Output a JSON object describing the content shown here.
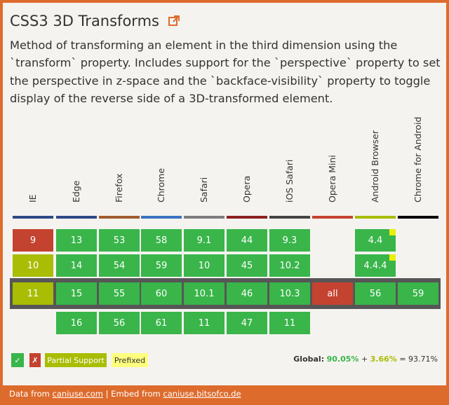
{
  "title": "CSS3 3D Transforms",
  "description": "Method of transforming an element in the third dimension using the `transform` property. Includes support for the `perspective` property to set the perspective in z-space and the `backface-visibility` property to toggle display of the reverse side of a 3D-transformed element.",
  "browsers": [
    {
      "name": "IE",
      "color": "#2e4986"
    },
    {
      "name": "Edge",
      "color": "#2e4986"
    },
    {
      "name": "Firefox",
      "color": "#a05b2d"
    },
    {
      "name": "Chrome",
      "color": "#3b73c0"
    },
    {
      "name": "Safari",
      "color": "#7d7d7d"
    },
    {
      "name": "Opera",
      "color": "#8b2020"
    },
    {
      "name": "iOS Safari",
      "color": "#444444"
    },
    {
      "name": "Opera Mini",
      "color": "#c44230"
    },
    {
      "name": "Android Browser",
      "color": "#a8bd04"
    },
    {
      "name": "Chrome for Android",
      "color": "#000000"
    }
  ],
  "versions": {
    "ie": [
      "9",
      "10",
      "11"
    ],
    "edge": [
      "13",
      "14",
      "15",
      "16"
    ],
    "firefox": [
      "53",
      "54",
      "55",
      "56"
    ],
    "chrome": [
      "58",
      "59",
      "60",
      "61"
    ],
    "safari": [
      "9.1",
      "10",
      "10.1",
      "11"
    ],
    "opera": [
      "44",
      "45",
      "46",
      "47"
    ],
    "ios_safari": [
      "9.3",
      "10.2",
      "10.3",
      "11"
    ],
    "opera_mini": [
      "all"
    ],
    "android": [
      "4.4",
      "4.4.4",
      "56"
    ],
    "chrome_android": [
      "59"
    ]
  },
  "legend": {
    "supported": "✓",
    "unsupported": "✗",
    "partial": "Partial Support",
    "prefixed": "Prefixed"
  },
  "global": {
    "label": "Global:",
    "supported": "90.05%",
    "plus": "+",
    "partial": "3.66%",
    "equals": "=",
    "total": "93.71%"
  },
  "footer": {
    "data_from": "Data from",
    "caniuse_link": "caniuse.com",
    "sep": "|",
    "embed_from": "Embed from",
    "embed_link": "caniuse.bitsofco.de"
  },
  "colors": {
    "accent": "#dd6b2c",
    "supported": "#39b54a",
    "unsupported": "#c44230",
    "partial": "#a8bd04",
    "prefixed": "#ffff7e"
  }
}
